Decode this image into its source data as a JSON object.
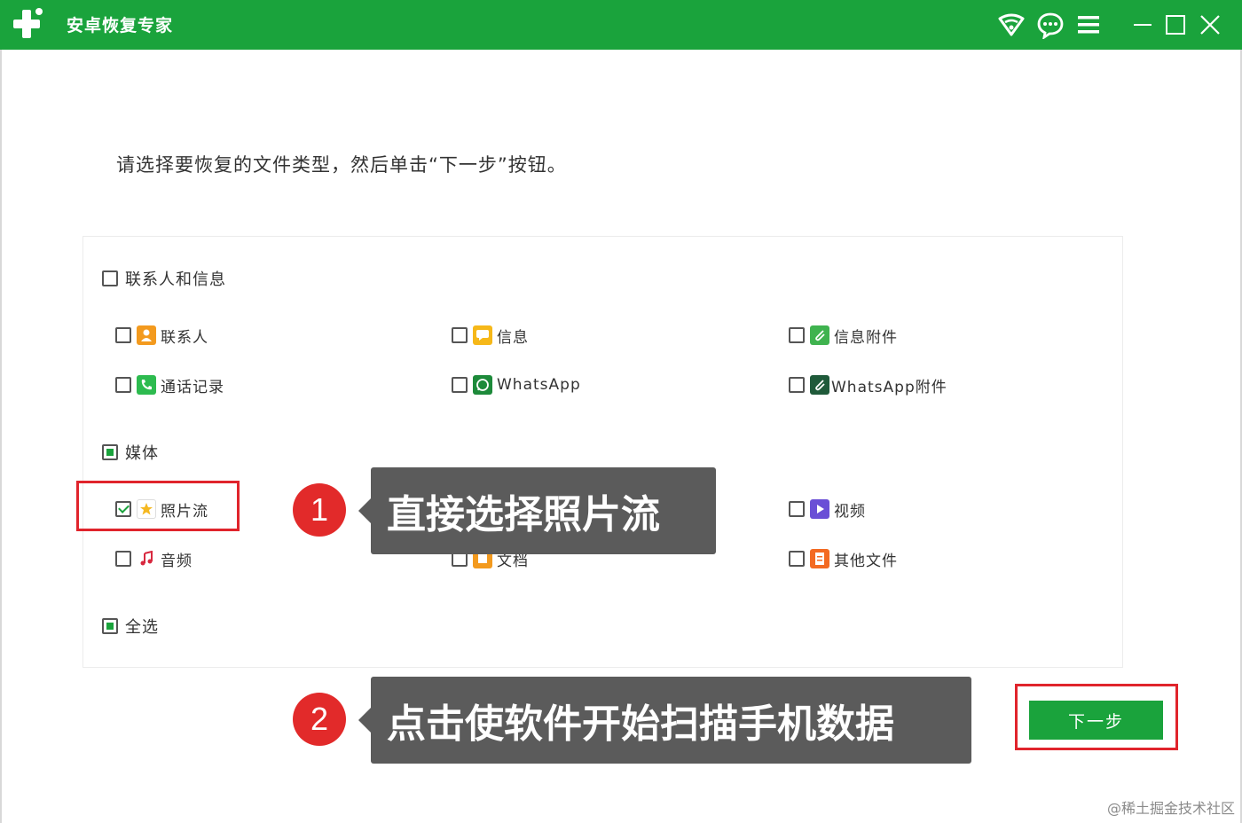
{
  "titlebar": {
    "app_title": "安卓恢复专家",
    "icons": [
      "wifi-icon",
      "feedback-icon",
      "menu-icon",
      "minimize-icon",
      "maximize-icon",
      "close-icon"
    ],
    "color": "#1aa33c"
  },
  "instruction": "请选择要恢复的文件类型，然后单击“下一步”按钮。",
  "groups": {
    "contacts_messages": {
      "label": "联系人和信息",
      "items": {
        "contacts": "联系人",
        "messages": "信息",
        "message_attachments": "信息附件",
        "call_logs": "通话记录",
        "whatsapp": "WhatsApp",
        "whatsapp_attachments": "WhatsApp附件"
      }
    },
    "media": {
      "label": "媒体",
      "items": {
        "photo_stream": "照片流",
        "video": "视频",
        "audio": "音频",
        "documents": "文档",
        "other_files": "其他文件"
      }
    },
    "select_all": "全选"
  },
  "annotations": {
    "step1_number": "1",
    "step1_text": "直接选择照片流",
    "step2_number": "2",
    "step2_text": "点击使软件开始扫描手机数据"
  },
  "next_button": "下一步",
  "watermark": "@稀土掘金技术社区"
}
